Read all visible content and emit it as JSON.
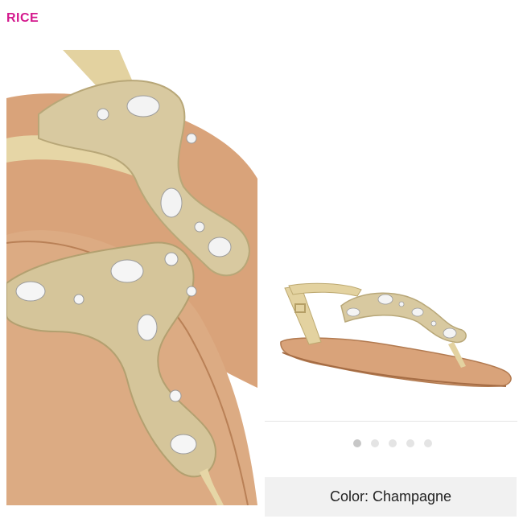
{
  "header": {
    "price_fragment": "RICE"
  },
  "product": {
    "images": [
      {
        "name": "closeup",
        "icon": "sandal-closeup-image"
      },
      {
        "name": "side",
        "icon": "sandal-side-image"
      }
    ],
    "carousel": {
      "count": 5,
      "active": 0
    },
    "color_label": "Color: Champagne"
  },
  "colors": {
    "accent": "#d4188d",
    "sole": "#d9a37a",
    "strap": "#e6d6a6",
    "jewel": "#efefef",
    "bar": "#f1f1f1"
  }
}
